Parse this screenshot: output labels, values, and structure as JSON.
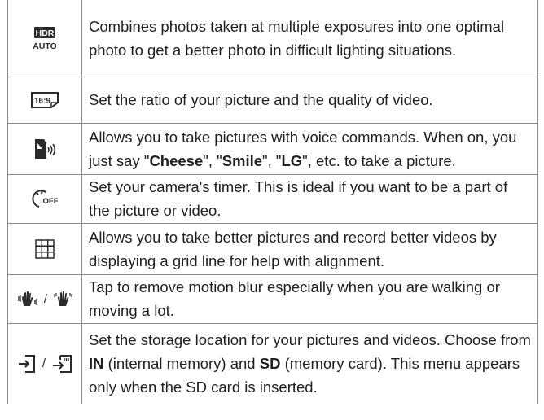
{
  "rows": [
    {
      "icon": "hdr-auto-icon",
      "icon_text_top": "HDR",
      "icon_text_bottom": "AUTO",
      "text": "Combines photos taken at multiple exposures into one optimal photo to get a better photo in difficult lighting situations."
    },
    {
      "icon": "aspect-ratio-icon",
      "icon_text": "16:9",
      "text": "Set the ratio of your picture and the quality of video."
    },
    {
      "icon": "voice-shutter-icon",
      "text_parts": [
        {
          "t": "Allows you to take pictures with voice commands. When on, you just say \"",
          "b": false
        },
        {
          "t": "Cheese",
          "b": true
        },
        {
          "t": "\", \"",
          "b": false
        },
        {
          "t": "Smile",
          "b": true
        },
        {
          "t": "\", \"",
          "b": false
        },
        {
          "t": "LG",
          "b": true
        },
        {
          "t": "\", etc. to take a picture.",
          "b": false
        }
      ]
    },
    {
      "icon": "timer-off-icon",
      "icon_text": "OFF",
      "text": "Set your camera's timer. This is ideal if you want to be a part of the picture or video."
    },
    {
      "icon": "grid-icon",
      "text": "Allows you to take better pictures and record better videos by displaying a grid line for help with alignment."
    },
    {
      "icon": "steady-shot-icon",
      "separator": "/",
      "text": "Tap to remove motion blur especially when you are walking or moving a lot."
    },
    {
      "icon": "storage-location-icon",
      "separator": "/",
      "text_parts": [
        {
          "t": "Set the storage location for your pictures and videos. Choose from ",
          "b": false
        },
        {
          "t": "IN",
          "b": true
        },
        {
          "t": " (internal memory) and ",
          "b": false
        },
        {
          "t": "SD",
          "b": true
        },
        {
          "t": " (memory card). This menu appears only when the SD card is inserted.",
          "b": false
        }
      ]
    }
  ]
}
